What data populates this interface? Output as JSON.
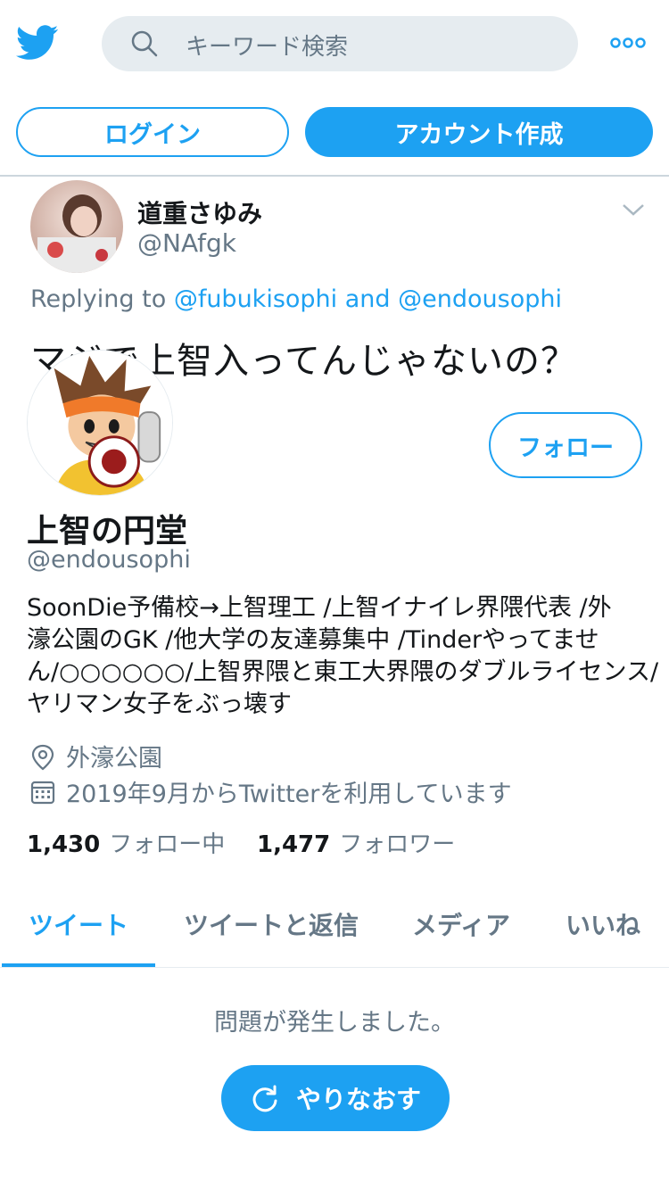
{
  "header": {
    "logo_icon": "twitter-bird-icon",
    "search_placeholder": "キーワード検索",
    "more_icon": "more-dots-icon"
  },
  "auth": {
    "login_label": "ログイン",
    "signup_label": "アカウント作成"
  },
  "tweet": {
    "author_name": "道重さゆみ",
    "author_handle": "@NAfgk",
    "reply_prefix": "Replying to",
    "reply_mention_1": "@fubukisophi",
    "reply_and": "and",
    "reply_mention_2": "@endousophi",
    "text": "マジで上智入ってんじゃないの？"
  },
  "profile": {
    "name": "上智の円堂",
    "handle": "@endousophi",
    "follow_label": "フォロー",
    "bio_lines": [
      "SoonDie予備校→上智理工 /上智イナイレ界隈代表 /外",
      "濠公園のGK /他大学の友達募集中 /Tinderやってませ",
      "ん/○○○○○○/上智界隈と東工大界隈のダブルライセンス/",
      "ヤリマン女子をぶっ壊す"
    ],
    "location": "外濠公園",
    "joined": "2019年9月からTwitterを利用しています",
    "following_count": "1,430",
    "following_label": "フォロー中",
    "followers_count": "1,477",
    "followers_label": "フォロワー"
  },
  "tabs": [
    {
      "label": "ツイート",
      "active": true
    },
    {
      "label": "ツイートと返信",
      "active": false
    },
    {
      "label": "メディア",
      "active": false
    },
    {
      "label": "いいね",
      "active": false
    }
  ],
  "error": {
    "message": "問題が発生しました。",
    "retry_label": "やりなおす"
  },
  "colors": {
    "accent": "#1da1f2",
    "secondary_text": "#657786",
    "primary_text": "#14171a",
    "search_bg": "#e6ecf0"
  }
}
